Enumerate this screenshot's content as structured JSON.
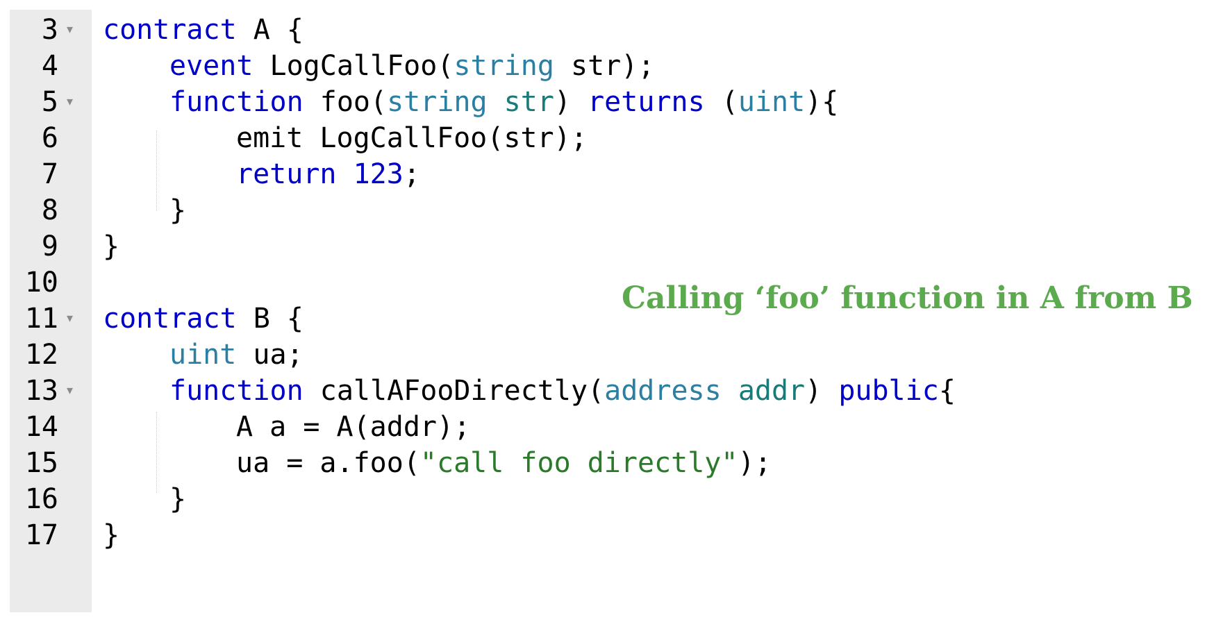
{
  "editor": {
    "lines": [
      {
        "number": "3",
        "fold": "▾",
        "indent": 0,
        "tokens": [
          [
            "kw",
            "contract"
          ],
          [
            "id",
            " A {"
          ]
        ]
      },
      {
        "number": "4",
        "fold": "",
        "indent": 1,
        "tokens": [
          [
            "kw",
            "event"
          ],
          [
            "id",
            " LogCallFoo("
          ],
          [
            "ty",
            "string"
          ],
          [
            "id",
            " str);"
          ]
        ]
      },
      {
        "number": "5",
        "fold": "▾",
        "indent": 1,
        "tokens": [
          [
            "kw",
            "function"
          ],
          [
            "id",
            " foo("
          ],
          [
            "ty",
            "string"
          ],
          [
            "id",
            " "
          ],
          [
            "param",
            "str"
          ],
          [
            "id",
            ") "
          ],
          [
            "kw",
            "returns"
          ],
          [
            "id",
            " ("
          ],
          [
            "ty",
            "uint"
          ],
          [
            "id",
            "){"
          ]
        ]
      },
      {
        "number": "6",
        "fold": "",
        "indent": 2,
        "tokens": [
          [
            "id",
            "emit LogCallFoo(str);"
          ]
        ]
      },
      {
        "number": "7",
        "fold": "",
        "indent": 2,
        "tokens": [
          [
            "kw",
            "return"
          ],
          [
            "id",
            " "
          ],
          [
            "num",
            "123"
          ],
          [
            "id",
            ";"
          ]
        ]
      },
      {
        "number": "8",
        "fold": "",
        "indent": 1,
        "tokens": [
          [
            "id",
            "}"
          ]
        ]
      },
      {
        "number": "9",
        "fold": "",
        "indent": 0,
        "tokens": [
          [
            "id",
            "}"
          ]
        ]
      },
      {
        "number": "10",
        "fold": "",
        "indent": 0,
        "tokens": []
      },
      {
        "number": "11",
        "fold": "▾",
        "indent": 0,
        "tokens": [
          [
            "kw",
            "contract"
          ],
          [
            "id",
            " B {"
          ]
        ]
      },
      {
        "number": "12",
        "fold": "",
        "indent": 1,
        "tokens": [
          [
            "ty",
            "uint"
          ],
          [
            "id",
            " ua;"
          ]
        ]
      },
      {
        "number": "13",
        "fold": "▾",
        "indent": 1,
        "tokens": [
          [
            "kw",
            "function"
          ],
          [
            "id",
            " callAFooDirectly("
          ],
          [
            "ty",
            "address"
          ],
          [
            "id",
            " "
          ],
          [
            "param",
            "addr"
          ],
          [
            "id",
            ") "
          ],
          [
            "kw",
            "public"
          ],
          [
            "id",
            "{"
          ]
        ]
      },
      {
        "number": "14",
        "fold": "",
        "indent": 2,
        "tokens": [
          [
            "id",
            "A a = A(addr);"
          ]
        ]
      },
      {
        "number": "15",
        "fold": "",
        "indent": 2,
        "tokens": [
          [
            "id",
            "ua = a.foo("
          ],
          [
            "str",
            "\"call foo directly\""
          ],
          [
            "id",
            ");"
          ]
        ]
      },
      {
        "number": "16",
        "fold": "",
        "indent": 1,
        "tokens": [
          [
            "id",
            "}"
          ]
        ]
      },
      {
        "number": "17",
        "fold": "",
        "indent": 0,
        "tokens": [
          [
            "id",
            "}"
          ]
        ]
      }
    ]
  },
  "annotation": {
    "text": "Calling ‘foo’ function in A from B",
    "color": "#5caa4e"
  },
  "colors": {
    "keyword": "#0000c8",
    "type": "#2b7fa3",
    "parameter": "#1a7a7a",
    "string": "#2a7a2a",
    "gutter": "#ebebeb"
  }
}
